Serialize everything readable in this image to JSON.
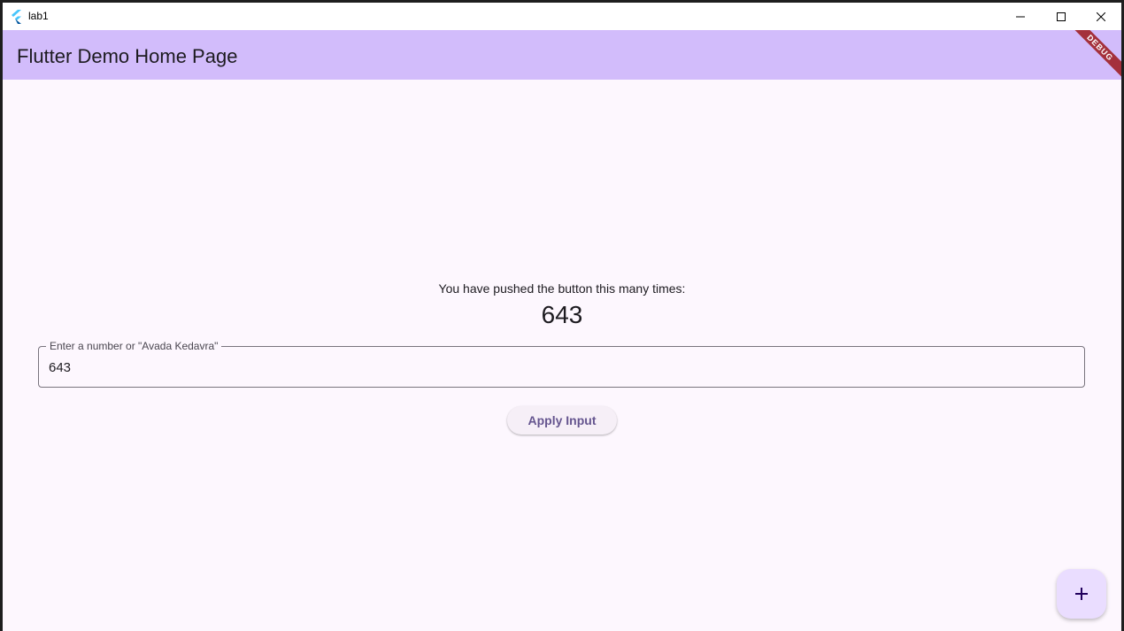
{
  "window": {
    "title": "lab1",
    "icons": {
      "app": "flutter-logo-icon",
      "minimize": "minimize-icon",
      "maximize": "maximize-icon",
      "close": "close-icon"
    }
  },
  "appbar": {
    "title": "Flutter Demo Home Page",
    "debug_banner": "DEBUG",
    "color": "#d2bcfb"
  },
  "main": {
    "counter_label": "You have pushed the button this many times:",
    "counter_value": "643",
    "input": {
      "label": "Enter a number or \"Avada Kedavra\"",
      "value": "643"
    },
    "apply_button": "Apply Input"
  },
  "fab": {
    "icon": "plus-icon",
    "color": "#eaddff"
  },
  "colors": {
    "background": "#fdf7fe",
    "primary_text": "#1d1b20",
    "button_text": "#65558f",
    "debug_banner": "#a4303c"
  }
}
